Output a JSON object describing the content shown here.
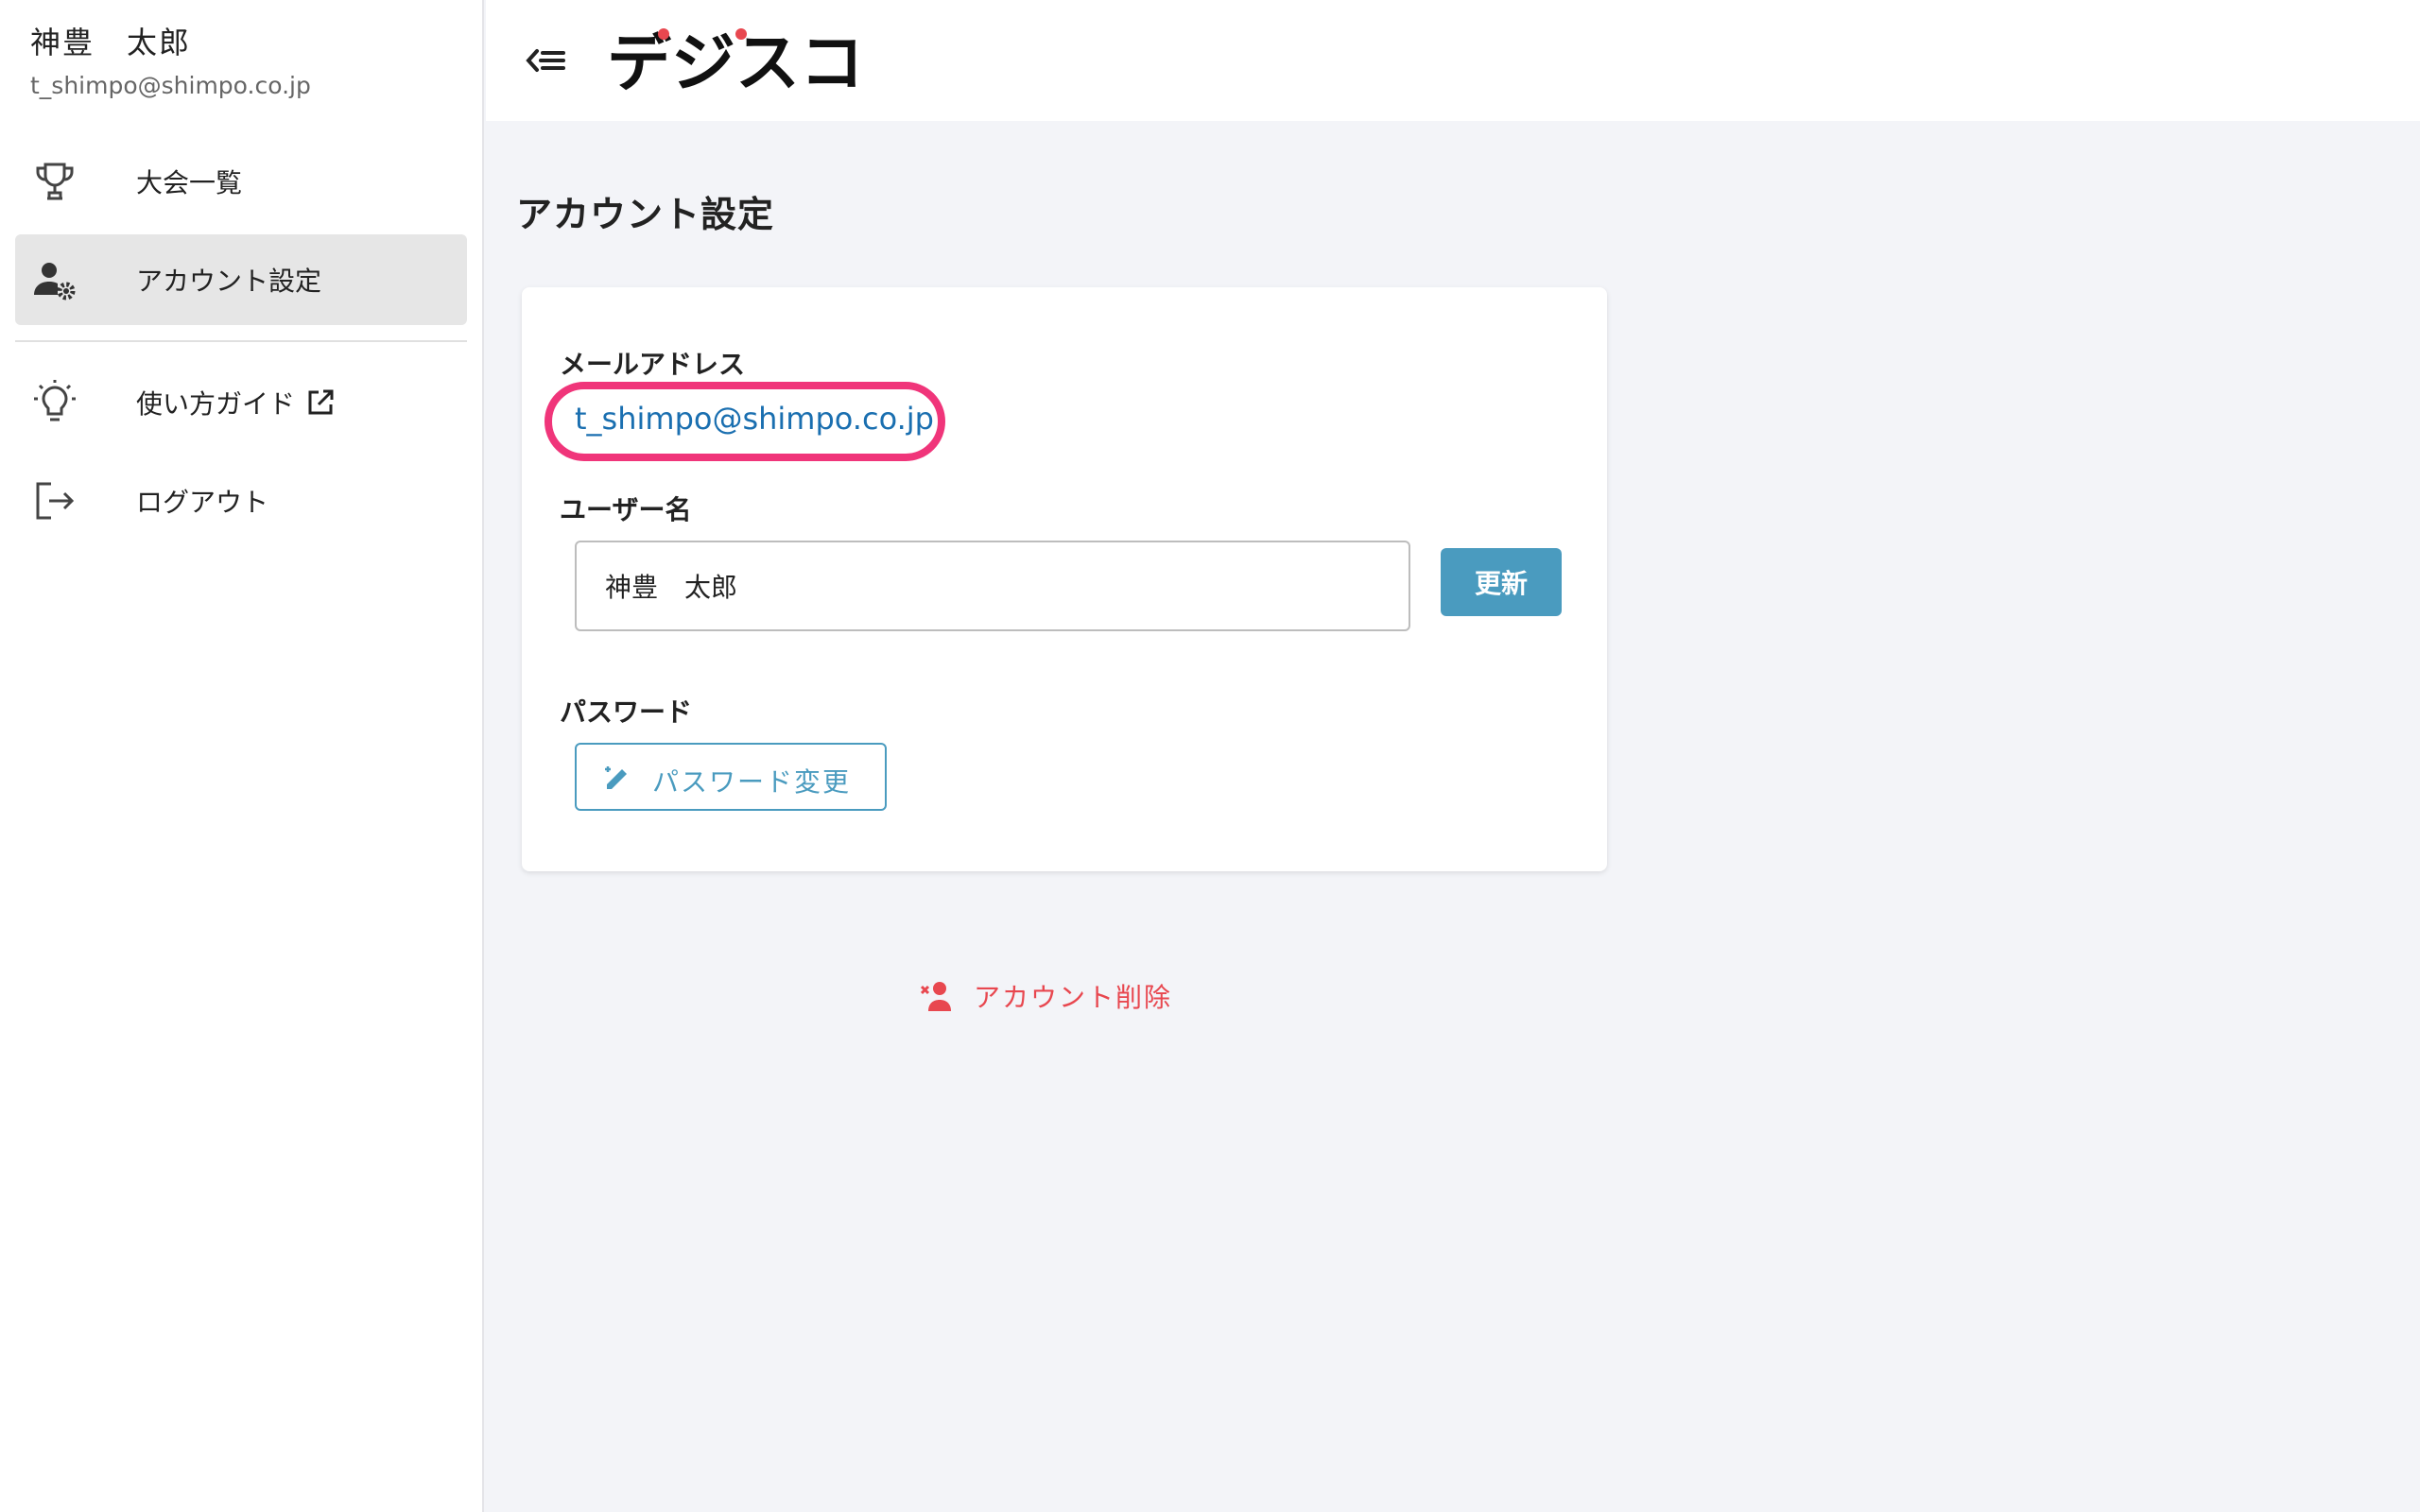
{
  "sidebar": {
    "user_name": "神豊　太郎",
    "user_email": "t_shimpo@shimpo.co.jp",
    "items": [
      {
        "label": "大会一覧",
        "icon": "trophy-icon"
      },
      {
        "label": "アカウント設定",
        "icon": "user-gear-icon",
        "active": true
      },
      {
        "label": "使い方ガイド",
        "icon": "lightbulb-icon",
        "external": true
      },
      {
        "label": "ログアウト",
        "icon": "logout-icon"
      }
    ]
  },
  "header": {
    "logo_text": "デジスコ",
    "menu_icon": "collapse-menu-icon"
  },
  "main": {
    "page_title": "アカウント設定",
    "email_label": "メールアドレス",
    "email_value": "t_shimpo@shimpo.co.jp",
    "username_label": "ユーザー名",
    "username_value": "神豊　太郎",
    "update_button": "更新",
    "password_label": "パスワード",
    "password_button": "パスワード変更",
    "delete_account": "アカウント削除"
  },
  "colors": {
    "accent": "#4a9bbf",
    "highlight": "#f0357a",
    "danger": "#e8474f",
    "link": "#1a6fb0"
  }
}
